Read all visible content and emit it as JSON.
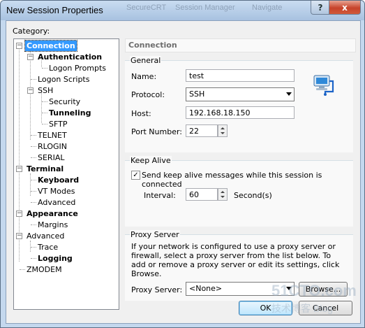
{
  "window": {
    "title": "New Session Properties",
    "background_tabs": [
      "SecureCRT",
      "Session Manager",
      "Navigate"
    ],
    "help_label": "?",
    "close_label": "x"
  },
  "category_label": "Category:",
  "tree": {
    "items": [
      {
        "label": "Connection",
        "bold": true,
        "selected": true
      },
      {
        "label": "Authentication",
        "bold": true
      },
      {
        "label": "Logon Prompts"
      },
      {
        "label": "Logon Scripts"
      },
      {
        "label": "SSH"
      },
      {
        "label": "Security"
      },
      {
        "label": "Tunneling",
        "bold": true
      },
      {
        "label": "SFTP"
      },
      {
        "label": "TELNET"
      },
      {
        "label": "RLOGIN"
      },
      {
        "label": "SERIAL"
      },
      {
        "label": "Terminal",
        "bold": true
      },
      {
        "label": "Keyboard",
        "bold": true
      },
      {
        "label": "VT Modes"
      },
      {
        "label": "Advanced"
      },
      {
        "label": "Appearance",
        "bold": true
      },
      {
        "label": "Margins"
      },
      {
        "label": "Advanced"
      },
      {
        "label": "Trace"
      },
      {
        "label": "Logging",
        "bold": true
      },
      {
        "label": "ZMODEM"
      }
    ],
    "toggle_symbol": "−"
  },
  "panel": {
    "header": "Connection",
    "general": {
      "title": "General",
      "name_label": "Name:",
      "name_value": "test",
      "protocol_label": "Protocol:",
      "protocol_value": "SSH",
      "host_label": "Host:",
      "host_value": "192.168.18.150",
      "port_label": "Port Number:",
      "port_value": "22"
    },
    "keepalive": {
      "title": "Keep Alive",
      "checkbox_label": "Send keep alive messages while this session is connected",
      "checked_mark": "✓",
      "interval_label": "Interval:",
      "interval_value": "60",
      "interval_unit": "Second(s)"
    },
    "proxy": {
      "title": "Proxy Server",
      "description": "If your network is configured to use a proxy server or firewall, select a proxy server from the list below. To add or remove a proxy server or edit its settings, click Browse.",
      "proxy_label": "Proxy Server:",
      "proxy_value": "<None>",
      "browse_label": "Browse..."
    }
  },
  "buttons": {
    "ok": "OK",
    "cancel": "Cancel"
  },
  "watermark": {
    "line1": "51CTO.com",
    "line2": "技术博客  Blog"
  },
  "colors": {
    "selection": "#3399ff",
    "titlebar": "#b9d1ea",
    "close_button": "#c7432b"
  }
}
